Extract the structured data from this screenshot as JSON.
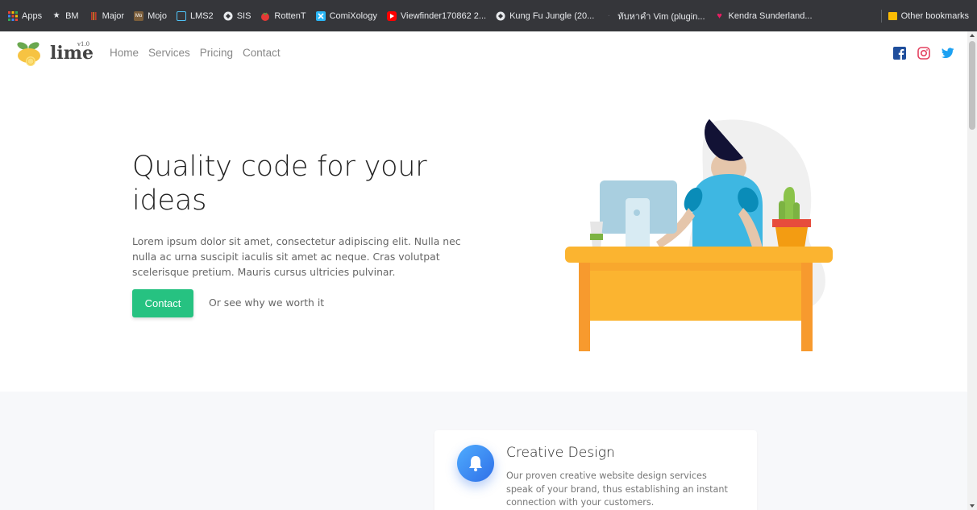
{
  "bookmarks": {
    "items": [
      {
        "label": "Apps",
        "icon": "apps-grid-icon",
        "color": "#e8453c"
      },
      {
        "label": "BM",
        "icon": "star-icon",
        "color": "#e8eaed"
      },
      {
        "label": "Major",
        "icon": "bars-icon",
        "color": "#c0392b"
      },
      {
        "label": "Mojo",
        "icon": "mojo-icon",
        "color": "#7b5e3b"
      },
      {
        "label": "LMS2",
        "icon": "lms-icon",
        "color": "#4fc3f7"
      },
      {
        "label": "SIS",
        "icon": "globe-icon",
        "color": "#e8eaed"
      },
      {
        "label": "RottenT",
        "icon": "tomato-icon",
        "color": "#e53935"
      },
      {
        "label": "ComiXology",
        "icon": "comixology-icon",
        "color": "#29b6f6"
      },
      {
        "label": "Viewfinder170862 2...",
        "icon": "youtube-icon",
        "color": "#ff0000"
      },
      {
        "label": "Kung Fu Jungle (20...",
        "icon": "globe-icon",
        "color": "#e8eaed"
      },
      {
        "label": "ทับหาคำ Vim (plugin...",
        "icon": "dot-icon",
        "color": "#5f6368"
      },
      {
        "label": "Kendra Sunderland...",
        "icon": "heart-icon",
        "color": "#e91e63"
      }
    ],
    "other": {
      "label": "Other bookmarks",
      "icon": "folder-icon",
      "color": "#fbbc04"
    }
  },
  "navbar": {
    "logo_text": "lime",
    "logo_version": "v1.0",
    "links": [
      "Home",
      "Services",
      "Pricing",
      "Contact"
    ],
    "socials": [
      {
        "name": "facebook-icon",
        "color": "#1f4e9c"
      },
      {
        "name": "instagram-icon",
        "color": "#e4405f"
      },
      {
        "name": "twitter-icon",
        "color": "#1da1f2"
      }
    ]
  },
  "hero": {
    "title": "Quality code for your ideas",
    "description": "Lorem ipsum dolor sit amet, consectetur adipiscing elit. Nulla nec nulla ac urna suscipit iaculis sit amet ac neque. Cras volutpat scelerisque pretium. Mauris cursus ultricies pulvinar.",
    "cta_label": "Contact",
    "secondary_link": "Or see why we worth it",
    "accent_color": "#26c281"
  },
  "features": {
    "card": {
      "title": "Creative Design",
      "description": "Our proven creative website design services speak of your brand, thus establishing an instant connection with your customers.",
      "icon": "bell-icon"
    }
  }
}
